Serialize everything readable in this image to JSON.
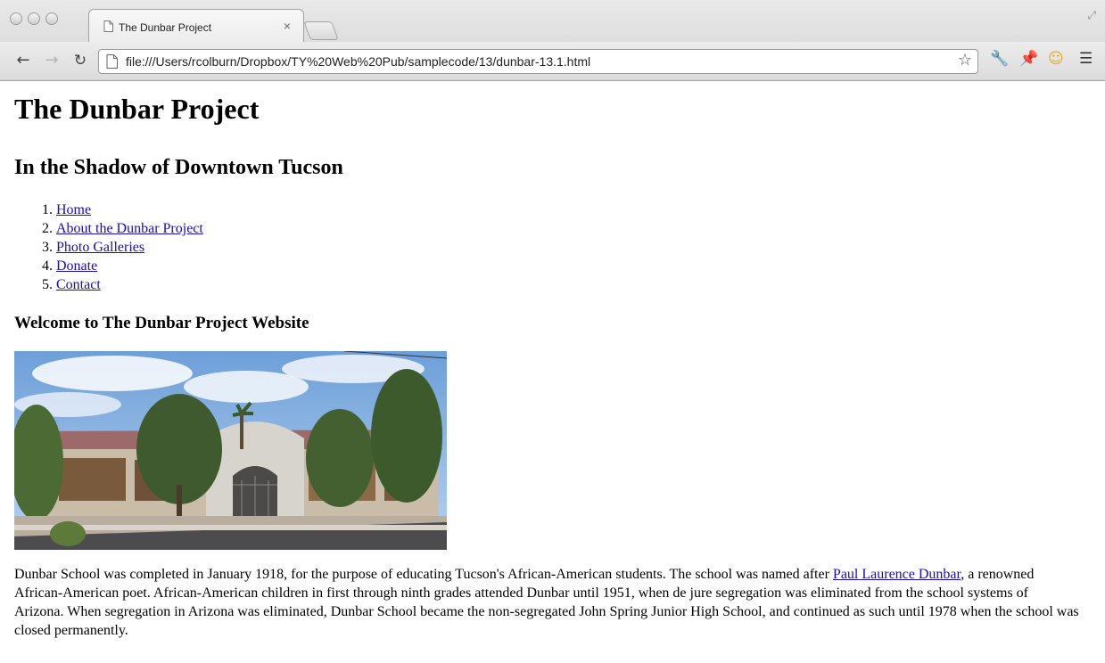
{
  "browser": {
    "tab_title": "The Dunbar Project",
    "tab_close": "×",
    "url": "file:///Users/rcolburn/Dropbox/TY%20Web%20Pub/samplecode/13/dunbar-13.1.html",
    "icons": [
      "back-arrow-icon",
      "forward-arrow-icon",
      "reload-icon",
      "page-icon",
      "bookmark-star-icon",
      "wrench-icon",
      "pin-icon",
      "extension-icon",
      "menu-icon"
    ]
  },
  "page": {
    "title": "The Dunbar Project",
    "subtitle": "In the Shadow of Downtown Tucson",
    "nav": [
      "Home",
      "About the Dunbar Project",
      "Photo Galleries",
      "Donate",
      "Contact"
    ],
    "welcome_heading": "Welcome to The Dunbar Project Website",
    "paragraph_before_link": "Dunbar School was completed in January 1918, for the purpose of educating Tucson's African-American students. The school was named after ",
    "paragraph_link": "Paul Laurence Dunbar",
    "paragraph_after_link": ", a renowned African-American poet. African-American children in first through ninth grades attended Dunbar until 1951, when de jure segregation was eliminated from the school systems of Arizona. When segregation in Arizona was eliminated, Dunbar School became the non-segregated John Spring Junior High School, and continued as such until 1978 when the school was closed permanently."
  }
}
